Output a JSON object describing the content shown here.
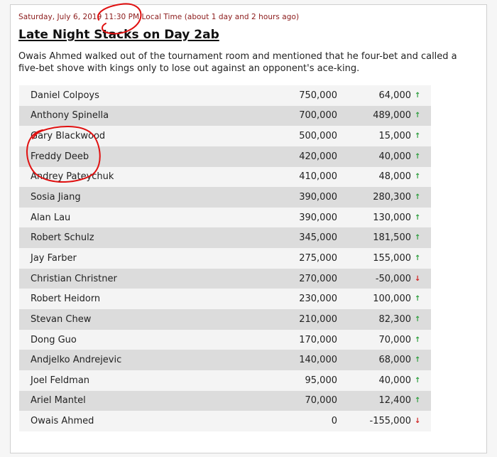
{
  "post": {
    "timestamp": "Saturday, July 6, 2019 11:30 PM Local Time (about 1 day and 2 hours ago)",
    "title": "Late Night Stacks on Day 2ab",
    "summary": "Owais Ahmed walked out of the tournament room and mentioned that he four-bet and called a five-bet shove with kings only to lose out against an opponent's ace-king."
  },
  "chip_counts": [
    {
      "player": "Daniel Colpoys",
      "chips": "750,000",
      "change": "64,000",
      "direction": "up"
    },
    {
      "player": "Anthony Spinella",
      "chips": "700,000",
      "change": "489,000",
      "direction": "up"
    },
    {
      "player": "Gary Blackwood",
      "chips": "500,000",
      "change": "15,000",
      "direction": "up"
    },
    {
      "player": "Freddy Deeb",
      "chips": "420,000",
      "change": "40,000",
      "direction": "up"
    },
    {
      "player": "Andrey Pateychuk",
      "chips": "410,000",
      "change": "48,000",
      "direction": "up"
    },
    {
      "player": "Sosia Jiang",
      "chips": "390,000",
      "change": "280,300",
      "direction": "up"
    },
    {
      "player": "Alan Lau",
      "chips": "390,000",
      "change": "130,000",
      "direction": "up"
    },
    {
      "player": "Robert Schulz",
      "chips": "345,000",
      "change": "181,500",
      "direction": "up"
    },
    {
      "player": "Jay Farber",
      "chips": "275,000",
      "change": "155,000",
      "direction": "up"
    },
    {
      "player": "Christian Christner",
      "chips": "270,000",
      "change": "-50,000",
      "direction": "down"
    },
    {
      "player": "Robert Heidorn",
      "chips": "230,000",
      "change": "100,000",
      "direction": "up"
    },
    {
      "player": "Stevan Chew",
      "chips": "210,000",
      "change": "82,300",
      "direction": "up"
    },
    {
      "player": "Dong Guo",
      "chips": "170,000",
      "change": "70,000",
      "direction": "up"
    },
    {
      "player": "Andjelko Andrejevic",
      "chips": "140,000",
      "change": "68,000",
      "direction": "up"
    },
    {
      "player": "Joel Feldman",
      "chips": "95,000",
      "change": "40,000",
      "direction": "up"
    },
    {
      "player": "Ariel Mantel",
      "chips": "70,000",
      "change": "12,400",
      "direction": "up"
    },
    {
      "player": "Owais Ahmed",
      "chips": "0",
      "change": "-155,000",
      "direction": "down"
    }
  ],
  "icons": {
    "up": "arrow-up-icon",
    "down": "arrow-down-icon"
  },
  "colors": {
    "timestamp": "#8b1a1a",
    "arrow_up": "#2e9e3e",
    "arrow_down": "#d0201f",
    "annotation": "#e01010"
  }
}
